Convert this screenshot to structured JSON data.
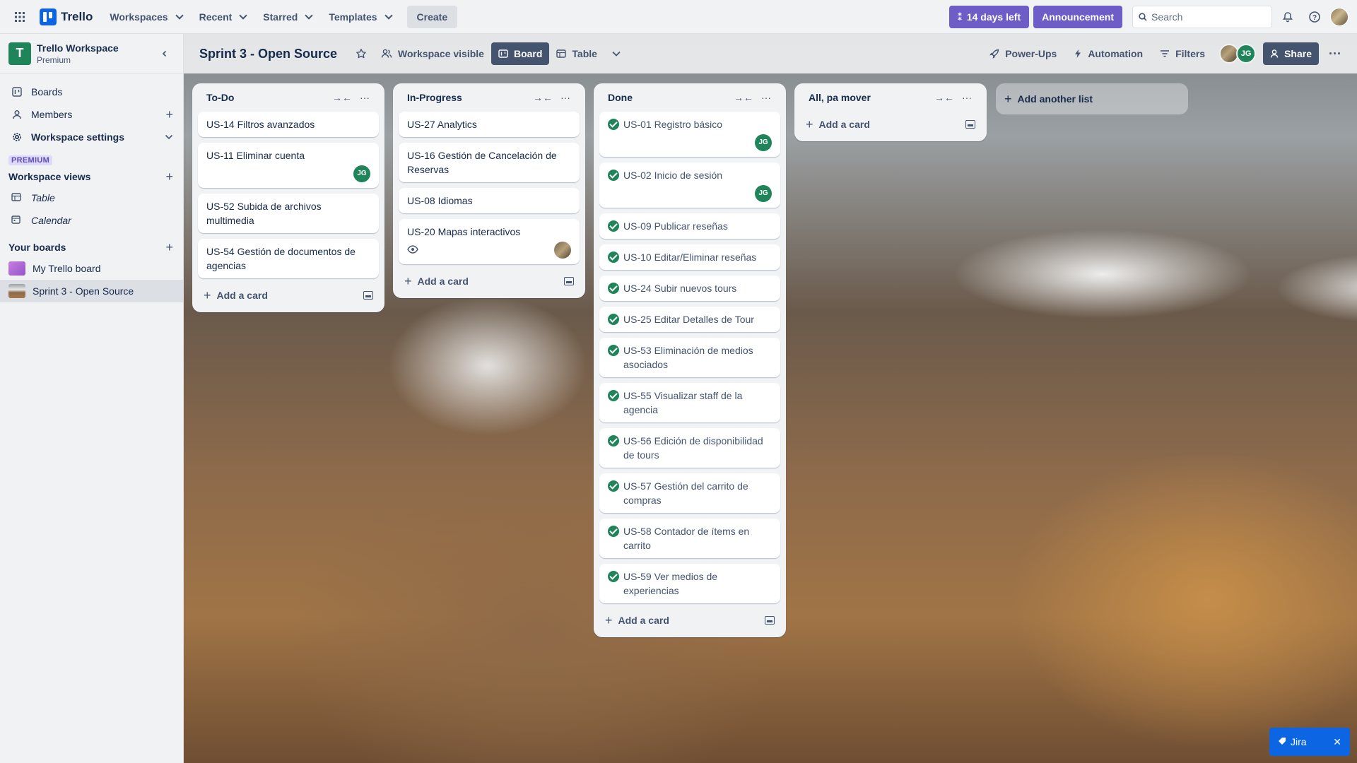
{
  "topbar": {
    "brand": "Trello",
    "nav": [
      {
        "label": "Workspaces"
      },
      {
        "label": "Recent"
      },
      {
        "label": "Starred"
      },
      {
        "label": "Templates"
      }
    ],
    "create_label": "Create",
    "trial_label": "14 days left",
    "announcement_label": "Announcement",
    "search_placeholder": "Search"
  },
  "sidebar": {
    "workspace_initial": "T",
    "workspace_name": "Trello Workspace",
    "workspace_plan": "Premium",
    "items": [
      {
        "label": "Boards"
      },
      {
        "label": "Members"
      },
      {
        "label": "Workspace settings"
      }
    ],
    "premium_badge": "PREMIUM",
    "views_title": "Workspace views",
    "views": [
      {
        "label": "Table"
      },
      {
        "label": "Calendar"
      }
    ],
    "boards_title": "Your boards",
    "boards": [
      {
        "label": "My Trello board",
        "color": "#b05fd6"
      },
      {
        "label": "Sprint 3 - Open Source",
        "color": "#8a6a4a"
      }
    ]
  },
  "board": {
    "title": "Sprint 3 - Open Source",
    "visibility_label": "Workspace visible",
    "view_board_label": "Board",
    "view_table_label": "Table",
    "powerups_label": "Power-Ups",
    "automation_label": "Automation",
    "filters_label": "Filters",
    "member_initials": "JG",
    "share_label": "Share",
    "add_list_label": "Add another list",
    "add_card_label": "Add a card"
  },
  "lists": {
    "todo": {
      "title": "To-Do",
      "cards": [
        {
          "title": "US-14 Filtros avanzados"
        },
        {
          "title": "US-11 Eliminar cuenta",
          "member": "JG"
        },
        {
          "title": "US-52 Subida de archivos multimedia"
        },
        {
          "title": "US-54 Gestión de documentos de agencias"
        }
      ]
    },
    "inprogress": {
      "title": "In-Progress",
      "cards": [
        {
          "title": "US-27 Analytics"
        },
        {
          "title": "US-16 Gestión de Cancelación de Reservas"
        },
        {
          "title": "US-08 Idiomas"
        },
        {
          "title": "US-20 Mapas interactivos"
        }
      ]
    },
    "done": {
      "title": "Done",
      "cards": [
        {
          "title": "US-01 Registro básico",
          "member": "JG"
        },
        {
          "title": "US-02 Inicio de sesión",
          "member": "JG"
        },
        {
          "title": "US-09 Publicar reseñas"
        },
        {
          "title": "US-10 Editar/Eliminar reseñas"
        },
        {
          "title": "US-24 Subir nuevos tours"
        },
        {
          "title": "US-25 Editar Detalles de Tour"
        },
        {
          "title": "US-53 Eliminación de medios asociados"
        },
        {
          "title": "US-55 Visualizar staff de la agencia"
        },
        {
          "title": "US-56 Edición de disponibilidad de tours"
        },
        {
          "title": "US-57 Gestión del carrito de compras"
        },
        {
          "title": "US-58 Contador de ítems en carrito"
        },
        {
          "title": "US-59 Ver medios de experiencias"
        }
      ]
    },
    "pamover": {
      "title": "All, pa mover",
      "cards": []
    }
  },
  "jira_label": "Jira",
  "colors": {
    "accent_purple": "#6e5dc6",
    "member_green": "#1f845a",
    "brand_blue": "#0c66e4"
  }
}
